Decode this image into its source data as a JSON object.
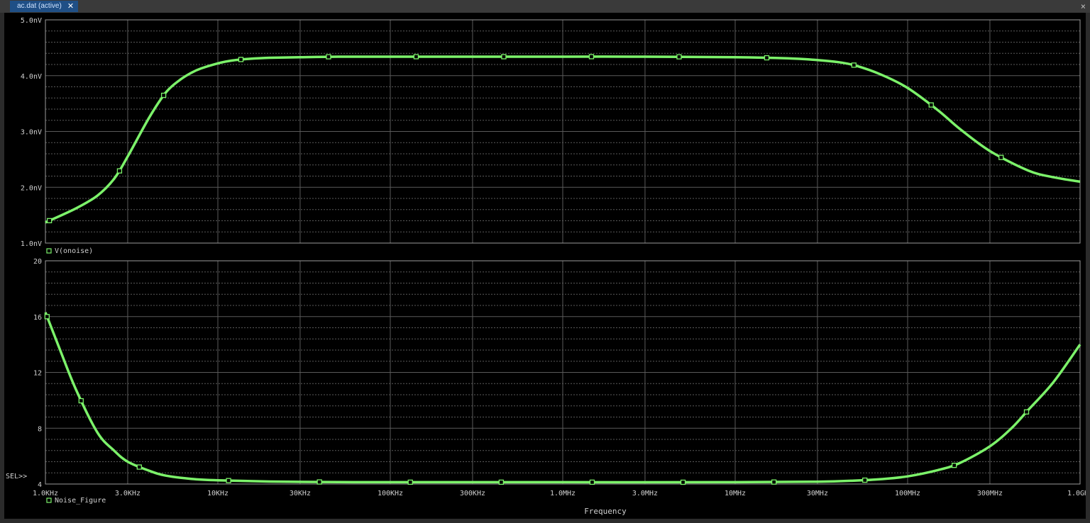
{
  "tab": {
    "label": "ac.dat (active)",
    "close_icon": "close-icon"
  },
  "colors": {
    "background": "#000000",
    "grid": "#5a5a5a",
    "trace": "#7cf26a",
    "text": "#d0d0d0"
  },
  "x_axis": {
    "label": "Frequency",
    "scale": "log",
    "range": [
      1000,
      1000000000
    ],
    "ticks": [
      {
        "value": 1000,
        "label": "1.0KHz"
      },
      {
        "value": 3000,
        "label": "3.0KHz"
      },
      {
        "value": 10000,
        "label": "10KHz"
      },
      {
        "value": 30000,
        "label": "30KHz"
      },
      {
        "value": 100000,
        "label": "100KHz"
      },
      {
        "value": 300000,
        "label": "300KHz"
      },
      {
        "value": 1000000,
        "label": "1.0MHz"
      },
      {
        "value": 3000000,
        "label": "3.0MHz"
      },
      {
        "value": 10000000,
        "label": "10MHz"
      },
      {
        "value": 30000000,
        "label": "30MHz"
      },
      {
        "value": 100000000,
        "label": "100MHz"
      },
      {
        "value": 300000000,
        "label": "300MHz"
      },
      {
        "value": 1000000000,
        "label": "1.0GHz"
      }
    ]
  },
  "sel_marker": "SEL>>",
  "chart_data": [
    {
      "type": "line",
      "ylim": [
        1.0,
        5.0
      ],
      "y_ticks": [
        {
          "value": 1.0,
          "label": "1.0nV"
        },
        {
          "value": 2.0,
          "label": "2.0nV"
        },
        {
          "value": 3.0,
          "label": "3.0nV"
        },
        {
          "value": 4.0,
          "label": "4.0nV"
        },
        {
          "value": 5.0,
          "label": "5.0nV"
        }
      ],
      "grid": true,
      "legend": "bottom-left",
      "series": [
        {
          "name": "V(onoise)",
          "x": [
            1000,
            1500,
            2000,
            2500,
            3000,
            4000,
            5000,
            6000,
            7000,
            8000,
            10000,
            12000,
            15000,
            20000,
            30000,
            50000,
            100000,
            300000,
            1000000,
            3000000,
            10000000,
            20000000,
            30000000,
            40000000,
            50000000,
            70000000,
            100000000,
            150000000,
            200000000,
            300000000,
            500000000,
            700000000,
            1000000000
          ],
          "y": [
            1.37,
            1.62,
            1.85,
            2.15,
            2.55,
            3.25,
            3.7,
            3.92,
            4.05,
            4.13,
            4.22,
            4.27,
            4.3,
            4.32,
            4.33,
            4.34,
            4.34,
            4.34,
            4.34,
            4.34,
            4.33,
            4.31,
            4.28,
            4.24,
            4.18,
            4.02,
            3.78,
            3.38,
            3.05,
            2.65,
            2.3,
            2.18,
            2.1
          ]
        }
      ]
    },
    {
      "type": "line",
      "ylim": [
        4,
        20
      ],
      "y_ticks": [
        {
          "value": 4,
          "label": "4"
        },
        {
          "value": 8,
          "label": "8"
        },
        {
          "value": 12,
          "label": "12"
        },
        {
          "value": 16,
          "label": "16"
        },
        {
          "value": 20,
          "label": "20"
        }
      ],
      "grid": true,
      "legend": "bottom-left",
      "series": [
        {
          "name": "Noise_Figure",
          "x": [
            1000,
            1200,
            1500,
            2000,
            2500,
            3000,
            4000,
            5000,
            7000,
            10000,
            20000,
            50000,
            100000,
            1000000,
            10000000,
            30000000,
            50000000,
            70000000,
            100000000,
            150000000,
            200000000,
            300000000,
            400000000,
            500000000,
            700000000,
            1000000000
          ],
          "y": [
            16.3,
            13.8,
            10.8,
            7.7,
            6.4,
            5.6,
            4.95,
            4.6,
            4.37,
            4.27,
            4.18,
            4.14,
            4.13,
            4.13,
            4.13,
            4.17,
            4.25,
            4.35,
            4.55,
            5.0,
            5.5,
            6.7,
            8.0,
            9.3,
            11.3,
            14.0
          ]
        }
      ]
    }
  ]
}
